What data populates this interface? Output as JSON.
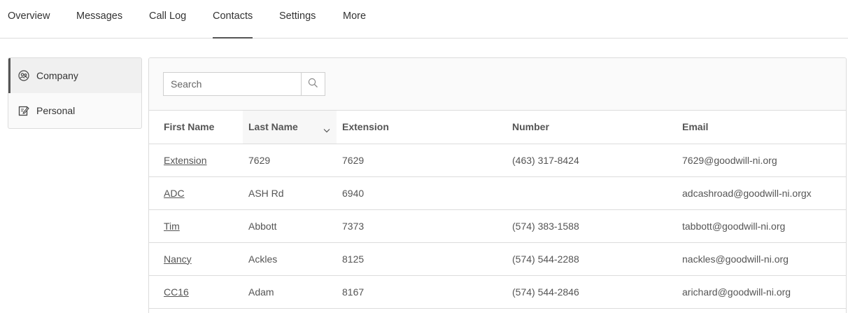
{
  "nav": {
    "tabs": [
      {
        "label": "Overview"
      },
      {
        "label": "Messages"
      },
      {
        "label": "Call Log"
      },
      {
        "label": "Contacts",
        "active": true
      },
      {
        "label": "Settings"
      },
      {
        "label": "More"
      }
    ]
  },
  "sidebar": {
    "items": [
      {
        "label": "Company",
        "icon": "group-icon",
        "active": true
      },
      {
        "label": "Personal",
        "icon": "edit-contact-icon"
      }
    ]
  },
  "search": {
    "placeholder": "Search",
    "value": "",
    "button_icon": "search-icon"
  },
  "table": {
    "columns": [
      "First Name",
      "Last Name",
      "Extension",
      "Number",
      "Email"
    ],
    "sorted_column": "Last Name",
    "sort_icon": "chevron-down-icon",
    "rows": [
      {
        "first": "Extension",
        "last": "7629",
        "ext": "7629",
        "number": "(463) 317-8424",
        "email": "7629@goodwill-ni.org"
      },
      {
        "first": "ADC",
        "last": "ASH Rd",
        "ext": "6940",
        "number": "",
        "email": "adcashroad@goodwill-ni.orgx"
      },
      {
        "first": "Tim",
        "last": "Abbott",
        "ext": "7373",
        "number": "(574) 383-1588",
        "email": "tabbott@goodwill-ni.org"
      },
      {
        "first": "Nancy",
        "last": "Ackles",
        "ext": "8125",
        "number": "(574) 544-2288",
        "email": "nackles@goodwill-ni.org"
      },
      {
        "first": "CC16",
        "last": "Adam",
        "ext": "8167",
        "number": "(574) 544-2846",
        "email": "arichard@goodwill-ni.org"
      }
    ]
  }
}
